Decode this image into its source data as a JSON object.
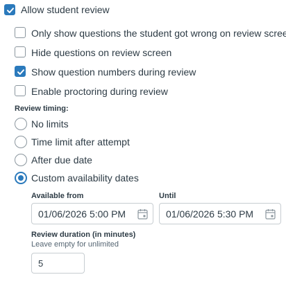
{
  "allow_review": {
    "label": "Allow student review",
    "checked": true
  },
  "options": [
    {
      "label": "Only show questions the student got wrong on review screen",
      "checked": false
    },
    {
      "label": "Hide questions on review screen",
      "checked": false
    },
    {
      "label": "Show question numbers during review",
      "checked": true
    },
    {
      "label": "Enable proctoring during review",
      "checked": false
    }
  ],
  "review_timing": {
    "heading": "Review timing:",
    "choices": [
      {
        "label": "No limits",
        "selected": false
      },
      {
        "label": "Time limit after attempt",
        "selected": false
      },
      {
        "label": "After due date",
        "selected": false
      },
      {
        "label": "Custom availability dates",
        "selected": true
      }
    ]
  },
  "availability": {
    "from_label": "Available from",
    "from_value": "01/06/2026 5:00 PM",
    "until_label": "Until",
    "until_value": "01/06/2026 5:30 PM"
  },
  "duration": {
    "label": "Review duration (in minutes)",
    "hint": "Leave empty for unlimited",
    "value": "5"
  },
  "colors": {
    "accent": "#2b7abc",
    "text": "#2d3b45",
    "border": "#c7cdd1"
  },
  "icons": {
    "checkbox_checked": "checkmark-icon",
    "date_picker": "calendar-icon"
  }
}
